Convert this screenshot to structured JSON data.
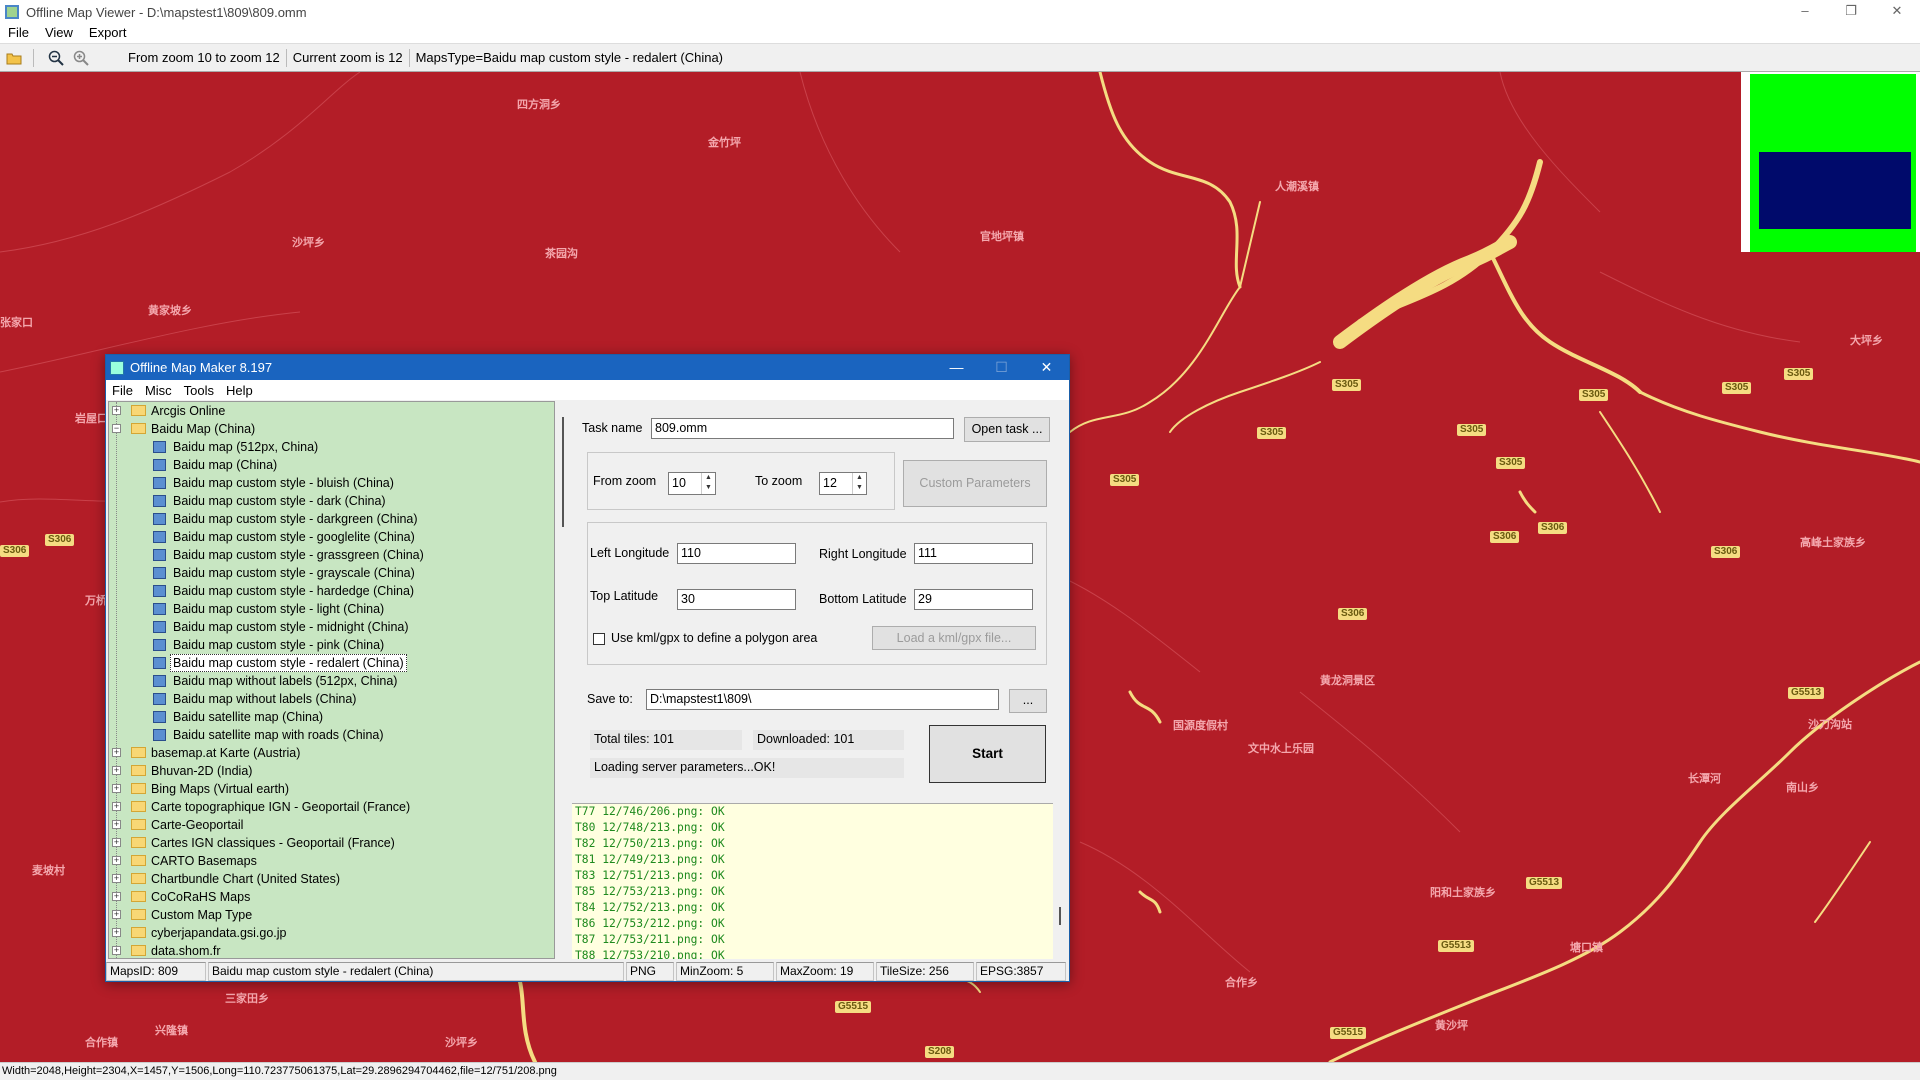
{
  "window": {
    "title": "Offline Map Viewer - D:\\mapstest1\\809\\809.omm",
    "menu": [
      "File",
      "View",
      "Export"
    ],
    "min": "–",
    "max": "❐",
    "close": "✕"
  },
  "toolbar": {
    "zoom_range": "From zoom 10 to zoom 12",
    "current_zoom": "Current zoom is 12",
    "maps_type": "MapsType=Baidu map custom style - redalert (China)"
  },
  "map": {
    "colors": {
      "background": "#b31d27",
      "roads": "#f5dc82",
      "labels": "#f4a7ad"
    },
    "places": [
      "四方洞乡",
      "金竹坪",
      "人潮溪镇",
      "沙坪乡",
      "官地坪镇",
      "茶园沟",
      "黄家坡乡",
      "张家口",
      "岩屋口",
      "万桥",
      "高峰土家族乡",
      "大坪乡",
      "黄龙洞景区",
      "文中水上乐园",
      "国源度假村",
      "沙刀沟站",
      "阳和土家族乡",
      "长潭河",
      "塘口镇",
      "麦坡村",
      "三家田乡",
      "合作乡",
      "黄沙坪",
      "沙坪乡",
      "兴隆镇",
      "南山乡",
      "合作镇"
    ],
    "roads": [
      "S305",
      "S305",
      "S305",
      "S305",
      "S305",
      "S305",
      "S305",
      "S306",
      "S306",
      "S306",
      "S306",
      "S306",
      "G5513",
      "G5513",
      "G5513",
      "G5515",
      "G5515",
      "S208",
      "S306",
      "S305"
    ]
  },
  "status": "Width=2048,Height=2304,X=1457,Y=1506,Long=110.723775061375,Lat=29.2896294704462,file=12/751/208.png",
  "dialog": {
    "title": "Offline Map Maker 8.197",
    "menu": [
      "File",
      "Misc",
      "Tools",
      "Help"
    ],
    "tree": [
      {
        "label": "Arcgis Online",
        "type": "folder",
        "exp": "+"
      },
      {
        "label": "Baidu Map (China)",
        "type": "folder",
        "exp": "−"
      },
      {
        "label": "Baidu map (512px, China)",
        "type": "child"
      },
      {
        "label": "Baidu map (China)",
        "type": "child"
      },
      {
        "label": "Baidu map custom style - bluish (China)",
        "type": "child"
      },
      {
        "label": "Baidu map custom style - dark (China)",
        "type": "child"
      },
      {
        "label": "Baidu map custom style - darkgreen (China)",
        "type": "child"
      },
      {
        "label": "Baidu map custom style - googlelite (China)",
        "type": "child"
      },
      {
        "label": "Baidu map custom style - grassgreen (China)",
        "type": "child"
      },
      {
        "label": "Baidu map custom style - grayscale (China)",
        "type": "child"
      },
      {
        "label": "Baidu map custom style - hardedge (China)",
        "type": "child"
      },
      {
        "label": "Baidu map custom style - light (China)",
        "type": "child"
      },
      {
        "label": "Baidu map custom style - midnight (China)",
        "type": "child"
      },
      {
        "label": "Baidu map custom style - pink (China)",
        "type": "child"
      },
      {
        "label": "Baidu map custom style - redalert (China)",
        "type": "child",
        "selected": true
      },
      {
        "label": "Baidu map without labels (512px, China)",
        "type": "child"
      },
      {
        "label": "Baidu map without labels (China)",
        "type": "child"
      },
      {
        "label": "Baidu satellite map (China)",
        "type": "child"
      },
      {
        "label": "Baidu satellite map with roads (China)",
        "type": "child"
      },
      {
        "label": "basemap.at Karte (Austria)",
        "type": "folder",
        "exp": "+"
      },
      {
        "label": "Bhuvan-2D (India)",
        "type": "folder",
        "exp": "+"
      },
      {
        "label": "Bing Maps (Virtual earth)",
        "type": "folder",
        "exp": "+"
      },
      {
        "label": "Carte topographique IGN - Geoportail (France)",
        "type": "folder",
        "exp": "+"
      },
      {
        "label": "Carte-Geoportail",
        "type": "folder",
        "exp": "+"
      },
      {
        "label": "Cartes IGN classiques - Geoportail (France)",
        "type": "folder",
        "exp": "+"
      },
      {
        "label": "CARTO Basemaps",
        "type": "folder",
        "exp": "+"
      },
      {
        "label": "Chartbundle Chart (United States)",
        "type": "folder",
        "exp": "+"
      },
      {
        "label": "CoCoRaHS Maps",
        "type": "folder",
        "exp": "+"
      },
      {
        "label": "Custom Map Type",
        "type": "folder",
        "exp": "+"
      },
      {
        "label": "cyberjapandata.gsi.go.jp",
        "type": "folder",
        "exp": "+"
      },
      {
        "label": "data.shom.fr",
        "type": "folder",
        "exp": "+"
      }
    ],
    "task_name_label": "Task name",
    "task_name": "809.omm",
    "open_task": "Open task ...",
    "from_zoom_label": "From zoom",
    "from_zoom": "10",
    "to_zoom_label": "To zoom",
    "to_zoom": "12",
    "custom_params": "Custom Parameters",
    "left_lon_label": "Left Longitude",
    "left_lon": "110",
    "right_lon_label": "Right Longitude",
    "right_lon": "111",
    "top_lat_label": "Top Latitude",
    "top_lat": "30",
    "bottom_lat_label": "Bottom Latitude",
    "bottom_lat": "29",
    "kml_check_label": "Use kml/gpx to define a polygon area",
    "load_kml": "Load a kml/gpx file...",
    "save_to_label": "Save to:",
    "save_to": "D:\\mapstest1\\809\\",
    "browse": "...",
    "total_tiles": "Total tiles: 101",
    "downloaded": "Downloaded: 101",
    "start": "Start",
    "loading": "Loading server parameters...OK!",
    "log": [
      "T77 12/746/206.png: OK",
      "T80 12/748/213.png: OK",
      "T82 12/750/213.png: OK",
      "T81 12/749/213.png: OK",
      "T83 12/751/213.png: OK",
      "T85 12/753/213.png: OK",
      "T84 12/752/213.png: OK",
      "T86 12/753/212.png: OK",
      "T87 12/753/211.png: OK",
      "T88 12/753/210.png: OK"
    ],
    "status": {
      "maps_id": "MapsID: 809",
      "name": "Baidu map custom style - redalert (China)",
      "format": "PNG",
      "min_zoom": "MinZoom: 5",
      "max_zoom": "MaxZoom: 19",
      "tile_size": "TileSize: 256",
      "epsg": "EPSG:3857"
    }
  }
}
